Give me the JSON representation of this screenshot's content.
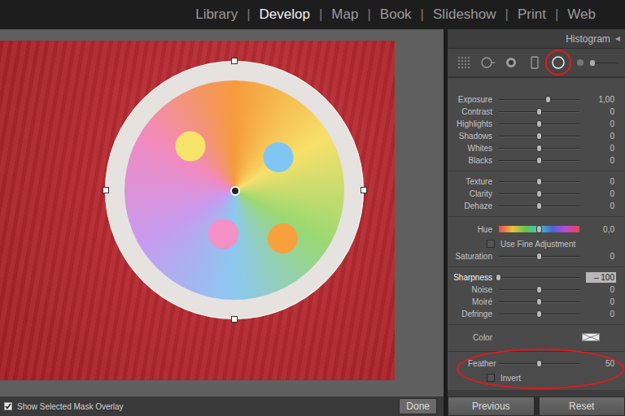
{
  "module_bar": {
    "items": [
      {
        "label": "Library",
        "selected": false
      },
      {
        "label": "Develop",
        "selected": true
      },
      {
        "label": "Map",
        "selected": false
      },
      {
        "label": "Book",
        "selected": false
      },
      {
        "label": "Slideshow",
        "selected": false
      },
      {
        "label": "Print",
        "selected": false
      },
      {
        "label": "Web",
        "selected": false
      }
    ],
    "separator": "|"
  },
  "canvas": {
    "mask_overlay": true
  },
  "canvas_toolbar": {
    "overlay_checkbox": {
      "label": "Show Selected Mask Overlay",
      "checked": true
    },
    "done_button": "Done"
  },
  "panel": {
    "header": {
      "title": "Histogram",
      "collapse_icon": "◀"
    },
    "tools": [
      {
        "kind": "crop",
        "selected": false
      },
      {
        "kind": "spot",
        "selected": false
      },
      {
        "kind": "redeye",
        "selected": false
      },
      {
        "kind": "graduated",
        "selected": false
      },
      {
        "kind": "radial",
        "selected": true
      }
    ],
    "tool_size": {
      "level": 0.05
    },
    "groups": [
      [
        {
          "kind": "slider",
          "label": "Exposure",
          "value": "1,00",
          "level": 0.62,
          "active": false
        },
        {
          "kind": "slider",
          "label": "Contrast",
          "value": "0",
          "level": 0.5,
          "active": false
        },
        {
          "kind": "slider",
          "label": "Highlights",
          "value": "0",
          "level": 0.5,
          "active": false
        },
        {
          "kind": "slider",
          "label": "Shadows",
          "value": "0",
          "level": 0.5,
          "active": false
        },
        {
          "kind": "slider",
          "label": "Whites",
          "value": "0",
          "level": 0.5,
          "active": false
        },
        {
          "kind": "slider",
          "label": "Blacks",
          "value": "0",
          "level": 0.5,
          "active": false
        }
      ],
      [
        {
          "kind": "slider",
          "label": "Texture",
          "value": "0",
          "level": 0.5,
          "active": false
        },
        {
          "kind": "slider",
          "label": "Clarity",
          "value": "0",
          "level": 0.5,
          "active": false
        },
        {
          "kind": "slider",
          "label": "Dehaze",
          "value": "0",
          "level": 0.5,
          "active": false
        }
      ],
      [
        {
          "kind": "hue",
          "label": "Hue",
          "value": "0,0",
          "level": 0.5,
          "active": false
        },
        {
          "kind": "checkbox",
          "label": "Use Fine Adjustment",
          "checked": false
        },
        {
          "kind": "slider",
          "label": "Saturation",
          "value": "0",
          "level": 0.5,
          "active": false
        }
      ],
      [
        {
          "kind": "slider",
          "label": "Sharpness",
          "value": "– 100",
          "level": 0.0,
          "active": true
        },
        {
          "kind": "slider",
          "label": "Noise",
          "value": "0",
          "level": 0.5,
          "active": false
        },
        {
          "kind": "slider",
          "label": "Moiré",
          "value": "0",
          "level": 0.5,
          "active": false
        },
        {
          "kind": "slider",
          "label": "Defringe",
          "value": "0",
          "level": 0.5,
          "active": false
        }
      ],
      [
        {
          "kind": "color",
          "label": "Color"
        }
      ]
    ],
    "feather": {
      "label": "Feather",
      "value": "50",
      "level": 0.5
    },
    "invert": {
      "label": "Invert",
      "checked": false
    }
  },
  "buttons": [
    {
      "label": "Previous"
    },
    {
      "label": "Reset"
    }
  ]
}
